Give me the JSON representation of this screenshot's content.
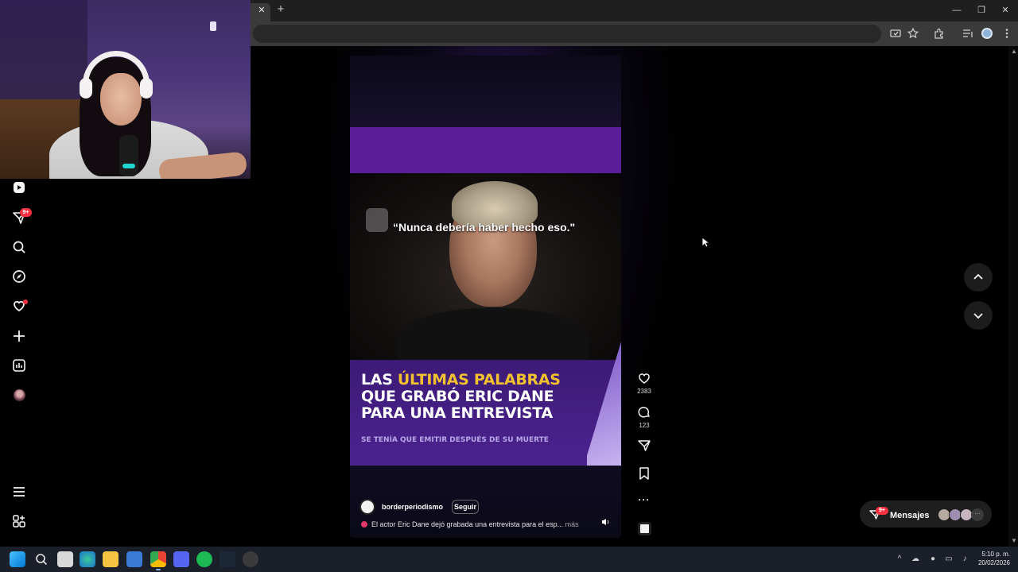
{
  "browser": {
    "tab_close_glyph": "✕",
    "new_tab_glyph": "+",
    "window_controls": [
      "—",
      "❐",
      "✕"
    ]
  },
  "reel": {
    "quote": "“Nunca debería haber hecho eso.\"",
    "headline_lines": [
      {
        "plain": "LAS ",
        "highlight": "ÚLTIMAS PALABRAS"
      },
      {
        "plain": "QUE GRABÓ ERIC DANE",
        "highlight": ""
      },
      {
        "plain": "PARA UNA ENTREVISTA",
        "highlight": ""
      }
    ],
    "subtitle": "SE TENÍA QUE EMITIR DESPUÉS DE SU MUERTE",
    "author": "borderperiodismo",
    "follow_label": "Seguir",
    "caption": "El actor Eric Dane dejó grabada una entrevista para el esp...",
    "caption_more": "más",
    "highlight_color": "#f2c12e",
    "accent_purple": "#5a1e98"
  },
  "actions": {
    "likes": "2383",
    "comments": "123"
  },
  "nav": {
    "notifications_badge": "9+"
  },
  "messages": {
    "label": "Mensajes",
    "badge": "9+",
    "more_glyph": "···"
  },
  "taskbar": {
    "time": "5:10 p. m.",
    "date": "20/02/2026"
  },
  "colors": {
    "badge_red": "#ff3040",
    "page_bg": "#000000"
  }
}
